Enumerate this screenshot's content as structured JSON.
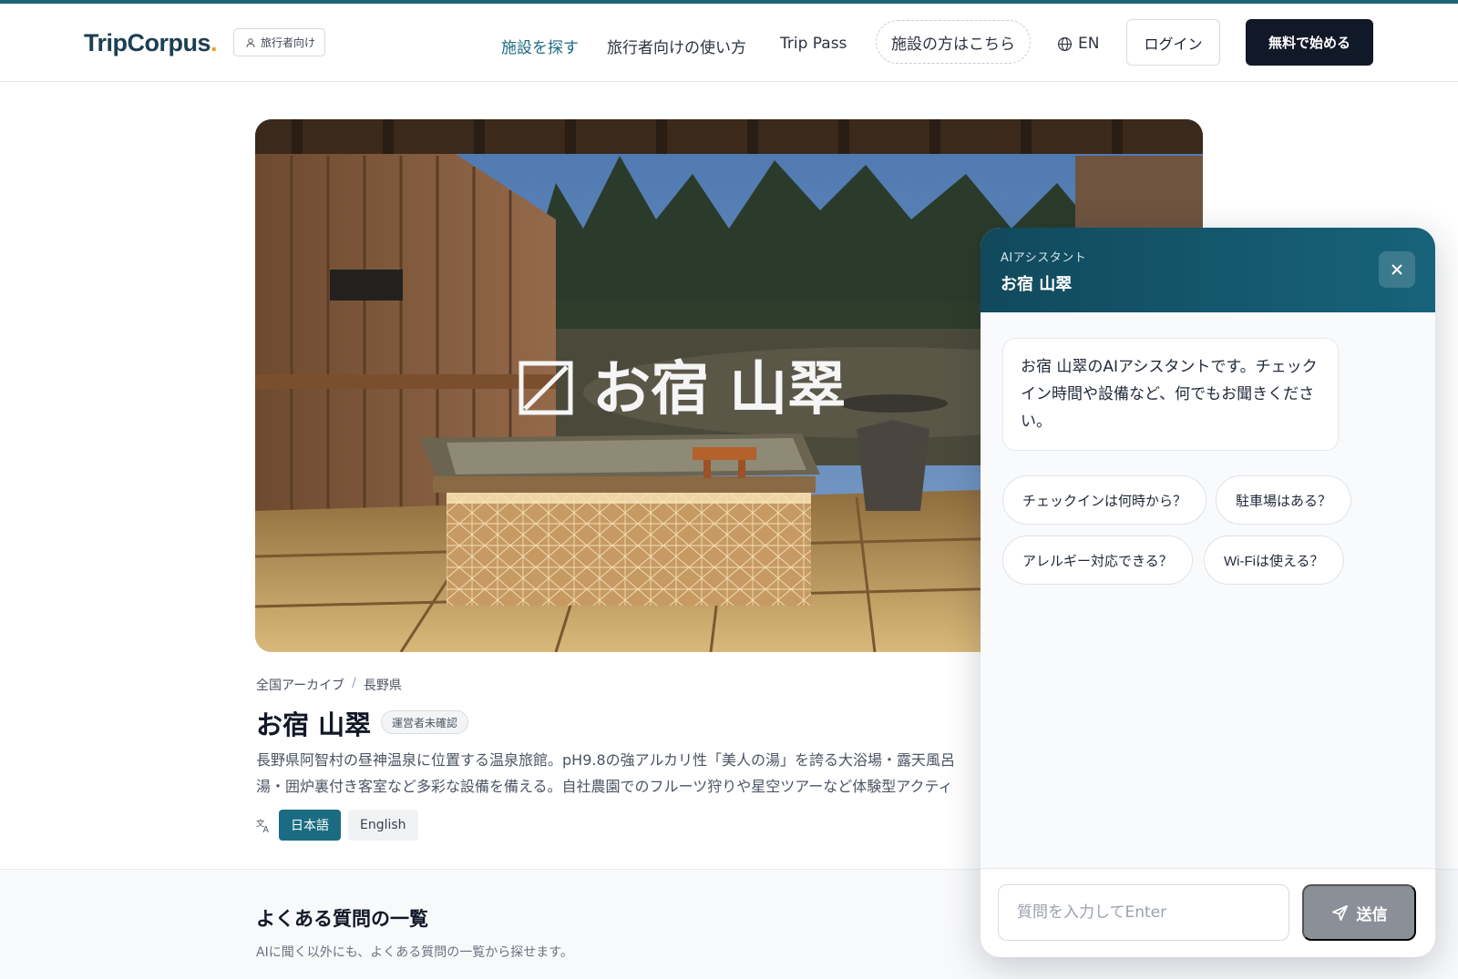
{
  "header": {
    "logo_text": "TripCorpus",
    "logo_dot": ".",
    "audience_badge": "旅行者向け",
    "nav": {
      "find": "施設を探す",
      "how_to": "旅行者向けの使い方",
      "trip_pass": "Trip Pass",
      "facility": "施設の方はこちら"
    },
    "lang": "EN",
    "login": "ログイン",
    "start": "無料で始める"
  },
  "hero": {
    "sign_text": "お宿 山翠"
  },
  "property": {
    "breadcrumb": [
      "全国アーカイブ",
      "/",
      "長野県"
    ],
    "title": "お宿 山翠",
    "badge": "運営者未確認",
    "description_line1": "長野県阿智村の昼神温泉に位置する温泉旅館。pH9.8の強アルカリ性「美人の湯」を誇る大浴場・露天風呂",
    "description_line2": "湯・囲炉裏付き客室など多彩な設備を備える。自社農園でのフルーツ狩りや星空ツアーなど体験型アクティ",
    "languages": {
      "ja": "日本語",
      "en": "English"
    }
  },
  "faq": {
    "title": "よくある質問の一覧",
    "subtitle": "AIに聞く以外にも、よくある質問の一覧から探せます。"
  },
  "chat": {
    "subtitle": "AIアシスタント",
    "title": "お宿 山翠",
    "greeting": "お宿 山翠のAIアシスタントです。チェックイン時間や設備など、何でもお聞きください。",
    "suggestions": [
      "チェックインは何時から？",
      "駐車場はある？",
      "アレルギー対応できる？",
      "Wi-Fiは使える？"
    ],
    "input_placeholder": "質問を入力してEnter",
    "send": "送信"
  },
  "colors": {
    "accent": "#1b6c82",
    "chat_header": "#11495c",
    "primary_button": "#111827",
    "send_button_disabled": "#8b9098"
  },
  "icons": [
    "user-icon",
    "globe-icon",
    "translate-icon",
    "close-icon",
    "send-icon"
  ]
}
